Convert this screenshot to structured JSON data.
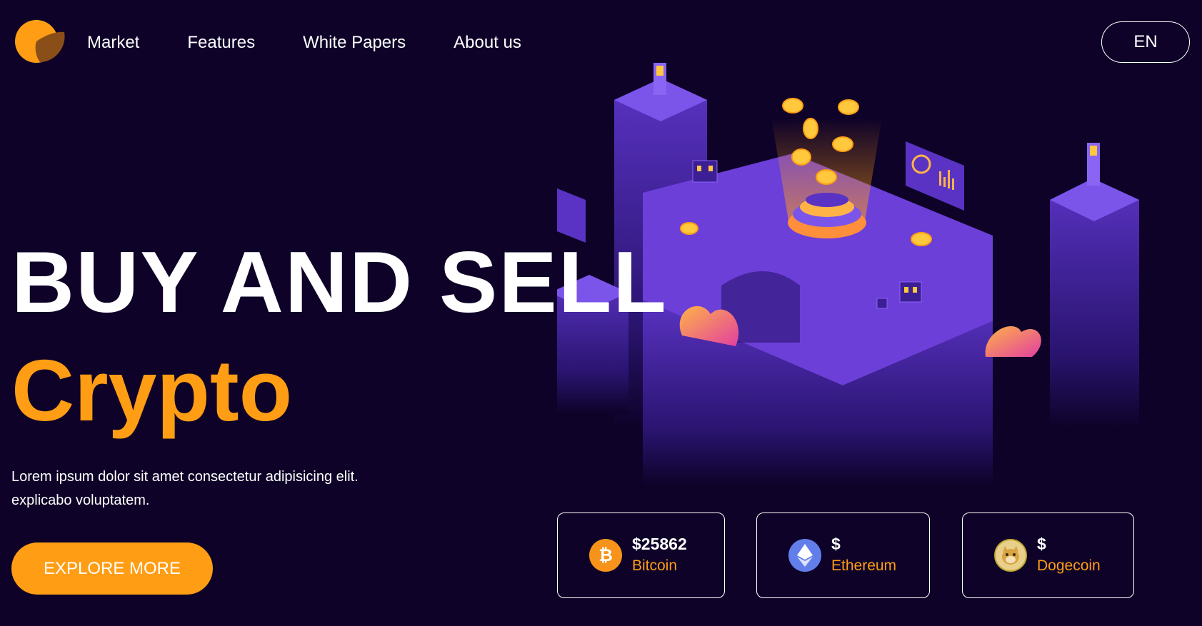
{
  "nav": {
    "items": [
      {
        "label": "Market"
      },
      {
        "label": "Features"
      },
      {
        "label": "White Papers"
      },
      {
        "label": "About us"
      }
    ],
    "language": "EN"
  },
  "hero": {
    "title_line1": "BUY AND SELL",
    "title_line2": "Crypto",
    "description_line1": "Lorem ipsum dolor sit amet consectetur adipisicing elit.",
    "description_line2": "explicabo voluptatem.",
    "cta_label": "EXPLORE MORE"
  },
  "coins": [
    {
      "price": "$25862",
      "name": "Bitcoin",
      "icon": "bitcoin-icon",
      "color": "#f7931a"
    },
    {
      "price": "$",
      "name": "Ethereum",
      "icon": "ethereum-icon",
      "color": "#627eea"
    },
    {
      "price": "$",
      "name": "Dogecoin",
      "icon": "dogecoin-icon",
      "color": "#c2a633"
    }
  ],
  "colors": {
    "background": "#0e0228",
    "accent": "#ff9d14",
    "purple": "#6c3fd8"
  }
}
